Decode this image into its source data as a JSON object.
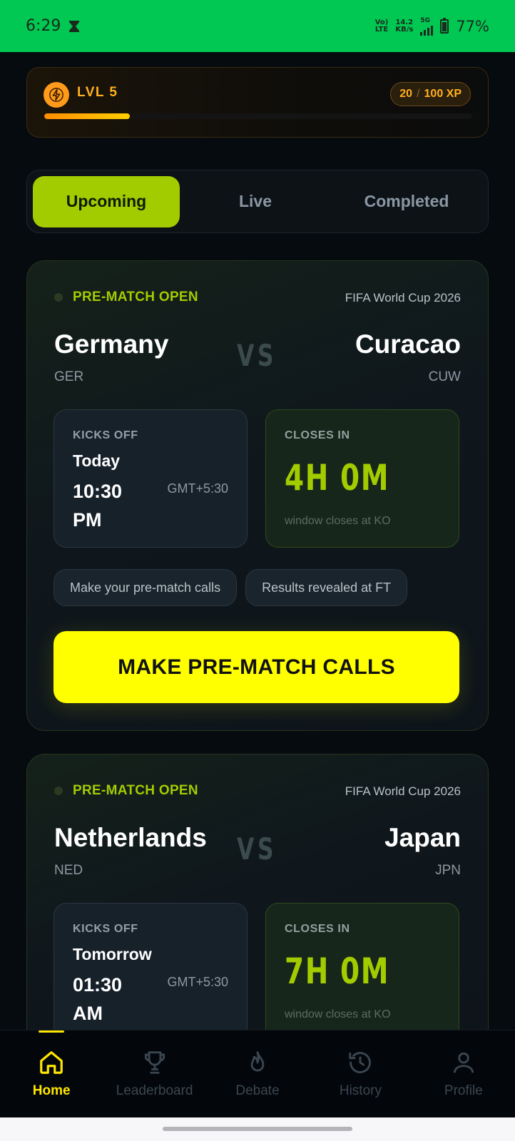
{
  "status_bar": {
    "time": "6:29",
    "volte_top": "Vo)",
    "volte_bottom": "LTE",
    "speed_value": "14.2",
    "speed_unit": "KB/s",
    "network": "5G",
    "battery": "77%",
    "battery_level": 0.77
  },
  "level": {
    "label": "LVL 5",
    "xp_current": "20",
    "xp_separator": "/",
    "xp_total": "100 XP",
    "progress": 0.2
  },
  "tabs": [
    {
      "label": "Upcoming",
      "active": true
    },
    {
      "label": "Live",
      "active": false
    },
    {
      "label": "Completed",
      "active": false
    }
  ],
  "matches": [
    {
      "status": "PRE-MATCH OPEN",
      "tournament": "FIFA World Cup 2026",
      "home": {
        "name": "Germany",
        "code": "GER"
      },
      "vs": "VS",
      "away": {
        "name": "Curacao",
        "code": "CUW"
      },
      "kickoff_label": "KICKS OFF",
      "kickoff_day": "Today",
      "kickoff_time": "10:30 PM",
      "kickoff_tz": "GMT+5:30",
      "closes_label": "CLOSES IN",
      "countdown": "4H 0M",
      "close_note": "window closes at KO",
      "chips": [
        "Make your pre-match calls",
        "Results revealed at FT"
      ],
      "cta": "MAKE PRE-MATCH CALLS"
    },
    {
      "status": "PRE-MATCH OPEN",
      "tournament": "FIFA World Cup 2026",
      "home": {
        "name": "Netherlands",
        "code": "NED"
      },
      "vs": "VS",
      "away": {
        "name": "Japan",
        "code": "JPN"
      },
      "kickoff_label": "KICKS OFF",
      "kickoff_day": "Tomorrow",
      "kickoff_time": "01:30 AM",
      "kickoff_tz": "GMT+5:30",
      "closes_label": "CLOSES IN",
      "countdown": "7H 0M",
      "close_note": "window closes at KO"
    }
  ],
  "bottom_nav": [
    {
      "label": "Home",
      "icon": "home-icon",
      "active": true
    },
    {
      "label": "Leaderboard",
      "icon": "trophy-icon",
      "active": false
    },
    {
      "label": "Debate",
      "icon": "flame-icon",
      "active": false
    },
    {
      "label": "History",
      "icon": "history-icon",
      "active": false
    },
    {
      "label": "Profile",
      "icon": "profile-icon",
      "active": false
    }
  ],
  "colors": {
    "accent_lime": "#a3cc00",
    "cta_yellow": "#ffff00",
    "xp_orange": "#ffb020",
    "status_bar_green": "#00c853"
  }
}
